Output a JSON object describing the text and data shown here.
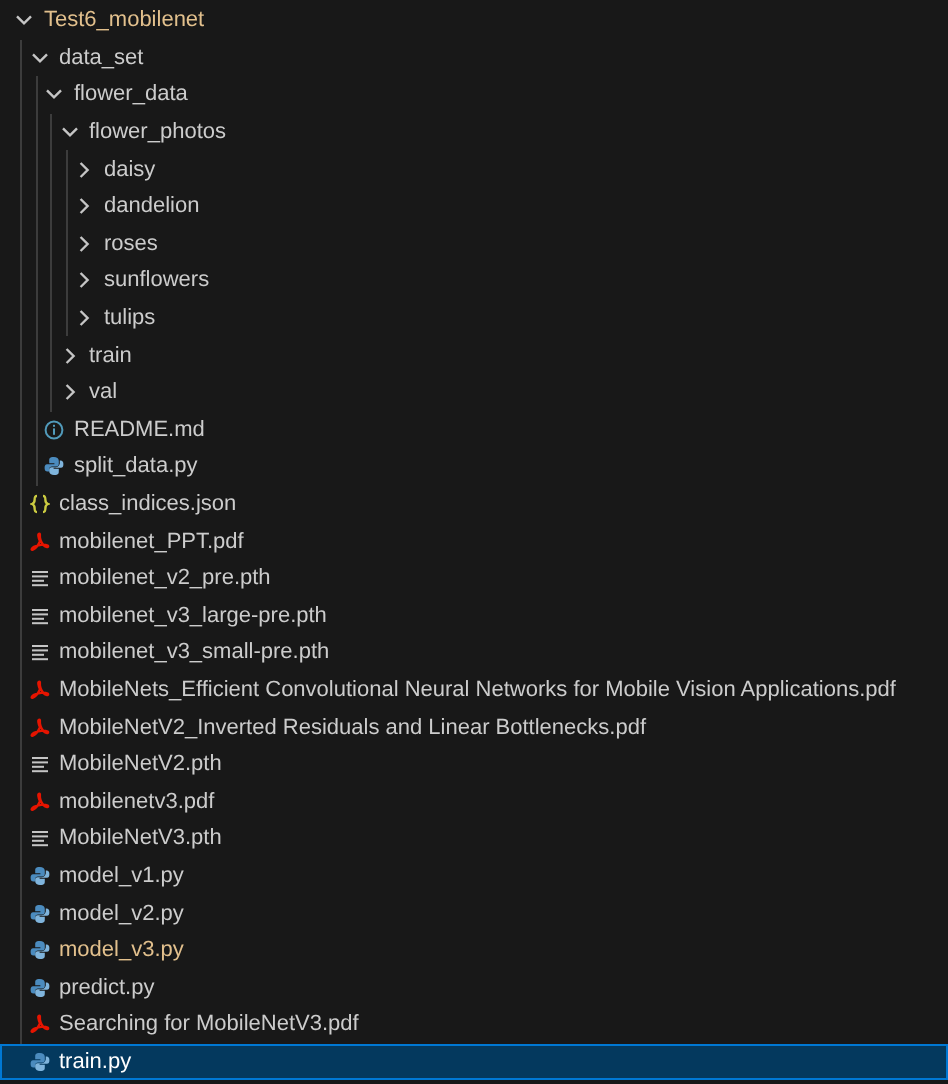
{
  "explorer": {
    "tree": [
      {
        "name": "Test6_mobilenet",
        "kind": "folder",
        "expanded": true,
        "modified": true,
        "selected": false,
        "children": [
          {
            "name": "data_set",
            "kind": "folder",
            "expanded": true,
            "modified": false,
            "selected": false,
            "children": [
              {
                "name": "flower_data",
                "kind": "folder",
                "expanded": true,
                "modified": false,
                "selected": false,
                "children": [
                  {
                    "name": "flower_photos",
                    "kind": "folder",
                    "expanded": true,
                    "modified": false,
                    "selected": false,
                    "children": [
                      {
                        "name": "daisy",
                        "kind": "folder",
                        "expanded": false,
                        "modified": false,
                        "selected": false
                      },
                      {
                        "name": "dandelion",
                        "kind": "folder",
                        "expanded": false,
                        "modified": false,
                        "selected": false
                      },
                      {
                        "name": "roses",
                        "kind": "folder",
                        "expanded": false,
                        "modified": false,
                        "selected": false
                      },
                      {
                        "name": "sunflowers",
                        "kind": "folder",
                        "expanded": false,
                        "modified": false,
                        "selected": false
                      },
                      {
                        "name": "tulips",
                        "kind": "folder",
                        "expanded": false,
                        "modified": false,
                        "selected": false
                      }
                    ]
                  },
                  {
                    "name": "train",
                    "kind": "folder",
                    "expanded": false,
                    "modified": false,
                    "selected": false
                  },
                  {
                    "name": "val",
                    "kind": "folder",
                    "expanded": false,
                    "modified": false,
                    "selected": false
                  }
                ]
              },
              {
                "name": "README.md",
                "kind": "markdown",
                "modified": false,
                "selected": false
              },
              {
                "name": "split_data.py",
                "kind": "python",
                "modified": false,
                "selected": false
              }
            ]
          },
          {
            "name": "class_indices.json",
            "kind": "json",
            "modified": false,
            "selected": false
          },
          {
            "name": "mobilenet_PPT.pdf",
            "kind": "pdf",
            "modified": false,
            "selected": false
          },
          {
            "name": "mobilenet_v2_pre.pth",
            "kind": "file",
            "modified": false,
            "selected": false
          },
          {
            "name": "mobilenet_v3_large-pre.pth",
            "kind": "file",
            "modified": false,
            "selected": false
          },
          {
            "name": "mobilenet_v3_small-pre.pth",
            "kind": "file",
            "modified": false,
            "selected": false
          },
          {
            "name": "MobileNets_Efficient Convolutional Neural Networks for Mobile Vision Applications.pdf",
            "kind": "pdf",
            "modified": false,
            "selected": false
          },
          {
            "name": "MobileNetV2_Inverted Residuals and Linear Bottlenecks.pdf",
            "kind": "pdf",
            "modified": false,
            "selected": false
          },
          {
            "name": "MobileNetV2.pth",
            "kind": "file",
            "modified": false,
            "selected": false
          },
          {
            "name": "mobilenetv3.pdf",
            "kind": "pdf",
            "modified": false,
            "selected": false
          },
          {
            "name": "MobileNetV3.pth",
            "kind": "file",
            "modified": false,
            "selected": false
          },
          {
            "name": "model_v1.py",
            "kind": "python",
            "modified": false,
            "selected": false
          },
          {
            "name": "model_v2.py",
            "kind": "python",
            "modified": false,
            "selected": false
          },
          {
            "name": "model_v3.py",
            "kind": "python",
            "modified": true,
            "selected": false
          },
          {
            "name": "predict.py",
            "kind": "python",
            "modified": false,
            "selected": false
          },
          {
            "name": "Searching for MobileNetV3.pdf",
            "kind": "pdf",
            "modified": false,
            "selected": false
          },
          {
            "name": "train.py",
            "kind": "python",
            "modified": false,
            "selected": true
          }
        ]
      }
    ]
  }
}
